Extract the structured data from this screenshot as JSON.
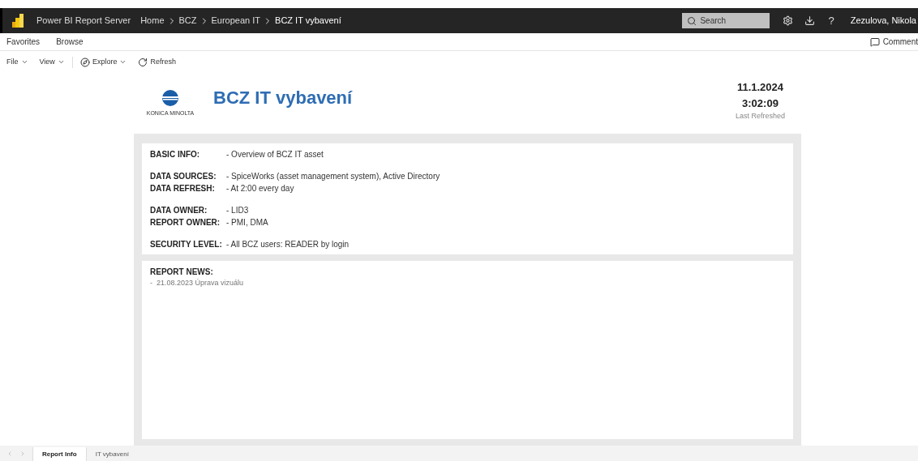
{
  "header": {
    "app_name": "Power BI Report Server",
    "breadcrumb": [
      "Home",
      "BCZ",
      "European IT",
      "BCZ IT vybavení"
    ],
    "search": {
      "placeholder": "Search"
    },
    "help": "?",
    "user": "Zezulova, Nikola"
  },
  "nav": {
    "items": [
      "Favorites",
      "Browse"
    ],
    "comments": "Comment"
  },
  "toolbar": [
    {
      "label": "File",
      "kind": "menu"
    },
    {
      "label": "View",
      "kind": "menu"
    },
    {
      "label": "Explore",
      "kind": "explore"
    },
    {
      "label": "Refresh",
      "kind": "refresh"
    }
  ],
  "report": {
    "logo_text": "KONICA MINOLTA",
    "title": "BCZ IT vybavení",
    "date": "11.1.2024",
    "time": "3:02:09",
    "refreshed_label": "Last Refreshed",
    "info_groups": [
      [
        {
          "label": "BASIC INFO:",
          "value": "- Overview of BCZ IT asset"
        }
      ],
      [
        {
          "label": "DATA SOURCES:",
          "value": "- SpiceWorks (asset management system), Active Directory"
        },
        {
          "label": "DATA REFRESH:",
          "value": "- At 2:00 every day"
        }
      ],
      [
        {
          "label": "DATA OWNER:",
          "value": "- LID3"
        },
        {
          "label": "REPORT OWNER:",
          "value": "- PMI, DMA"
        }
      ],
      [
        {
          "label": "SECURITY LEVEL:",
          "value": "- All BCZ users: READER by login"
        }
      ]
    ],
    "news_title": "REPORT NEWS:",
    "news": [
      "-  21.08.2023 Úprava vizuálu"
    ]
  },
  "pages": [
    {
      "label": "Report Info",
      "selected": true
    },
    {
      "label": "IT vybavení",
      "selected": false
    }
  ]
}
